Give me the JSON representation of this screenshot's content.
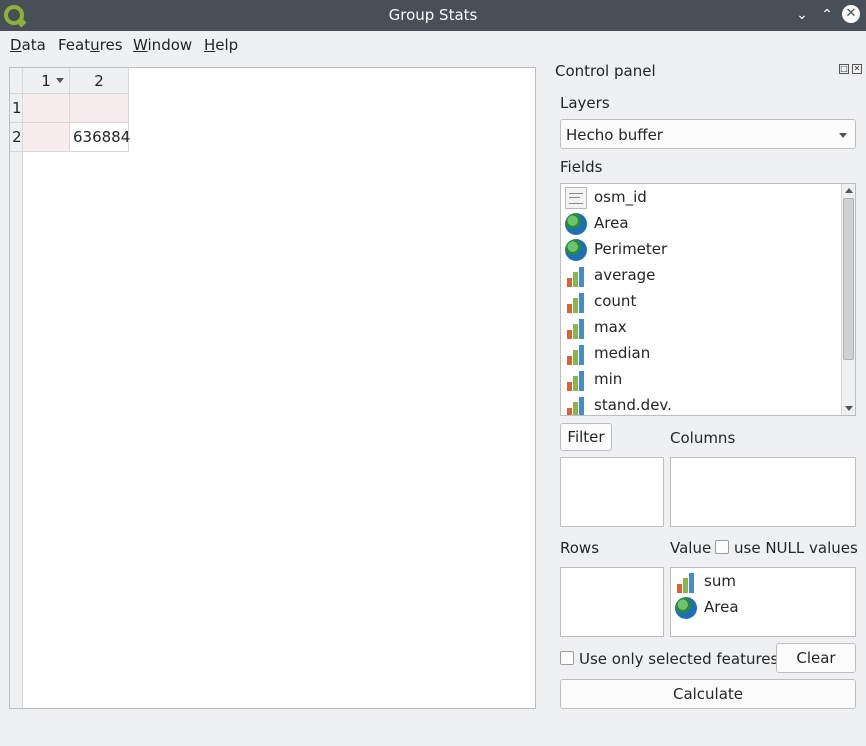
{
  "window": {
    "title": "Group Stats"
  },
  "menu": [
    {
      "mnemonic": "D",
      "rest": "ata"
    },
    {
      "pre": "Feat",
      "mnemonic": "u",
      "post": "res"
    },
    {
      "mnemonic": "W",
      "rest": "indow"
    },
    {
      "mnemonic": "H",
      "rest": "elp"
    }
  ],
  "table": {
    "columns": [
      "1",
      "2"
    ],
    "rows": [
      {
        "header": "1",
        "cells": [
          "",
          ""
        ]
      },
      {
        "header": "2",
        "cells": [
          "",
          "636884"
        ]
      }
    ]
  },
  "control_panel": {
    "title": "Control panel",
    "layers_label": "Layers",
    "layer_selected": "Hecho buffer",
    "fields_label": "Fields",
    "fields": [
      {
        "name": "osm_id",
        "icon": "text-field-icon"
      },
      {
        "name": "Area",
        "icon": "globe-icon"
      },
      {
        "name": "Perimeter",
        "icon": "globe-icon"
      },
      {
        "name": "average",
        "icon": "bar-chart-icon"
      },
      {
        "name": "count",
        "icon": "bar-chart-icon"
      },
      {
        "name": "max",
        "icon": "bar-chart-icon"
      },
      {
        "name": "median",
        "icon": "bar-chart-icon"
      },
      {
        "name": "min",
        "icon": "bar-chart-icon"
      },
      {
        "name": "stand.dev.",
        "icon": "bar-chart-icon"
      }
    ],
    "filter_button": "Filter",
    "columns_label": "Columns",
    "rows_label": "Rows",
    "value_label": "Value",
    "use_null_label": "use NULL values",
    "value_items": [
      {
        "name": "sum",
        "icon": "bar-chart-icon"
      },
      {
        "name": "Area",
        "icon": "globe-icon"
      }
    ],
    "use_selected_label": "Use only selected features",
    "clear_button": "Clear",
    "calculate_button": "Calculate"
  }
}
